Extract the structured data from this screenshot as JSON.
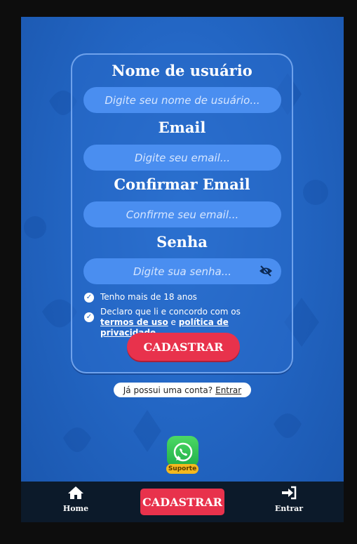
{
  "form": {
    "username": {
      "label": "Nome de usuário",
      "placeholder": "Digite seu nome de usuário..."
    },
    "email": {
      "label": "Email",
      "placeholder": "Digite seu email..."
    },
    "confirm_email": {
      "label": "Confirmar Email",
      "placeholder": "Confirme seu email..."
    },
    "password": {
      "label": "Senha",
      "placeholder": "Digite sua senha..."
    },
    "age_check": "Tenho mais de 18 anos",
    "terms_prefix": "Declaro que li e concordo com os",
    "terms_link": "termos de uso",
    "terms_and": "e",
    "privacy_link": "política de privacidade",
    "submit_label": "CADASTRAR"
  },
  "login_prompt": {
    "text": "Já possui uma conta?",
    "link": "Entrar"
  },
  "support": {
    "label": "Suporte"
  },
  "bottom_nav": {
    "home": "Home",
    "register": "CADASTRAR",
    "login": "Entrar"
  },
  "colors": {
    "primary_bg": "#2366c4",
    "accent": "#e8324c",
    "nav_bg": "#0c1a2a"
  }
}
